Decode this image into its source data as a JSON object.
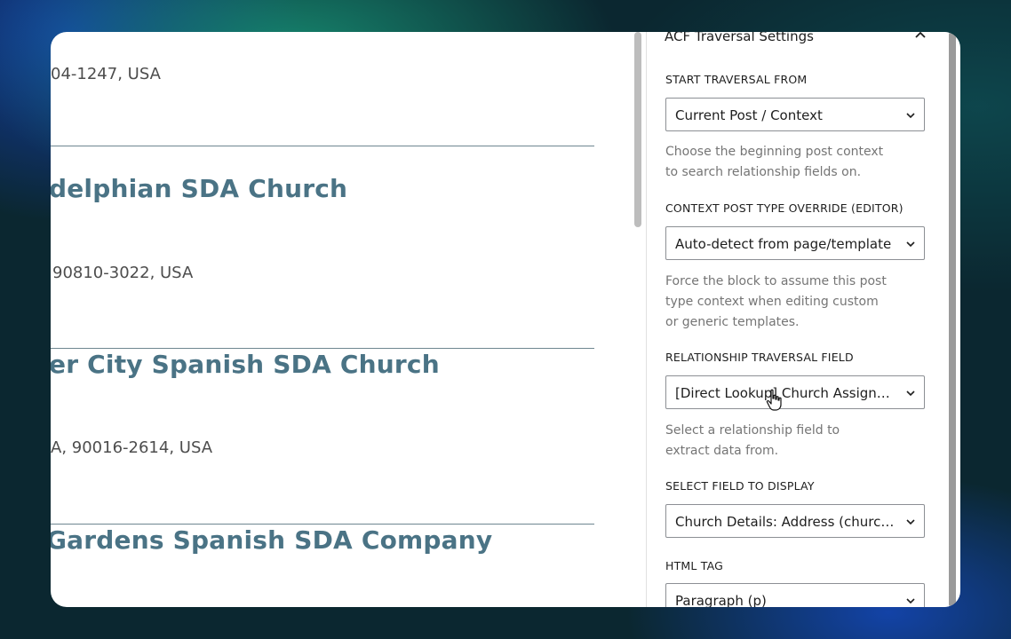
{
  "content": {
    "entries": [
      {
        "title": "",
        "address": "04-1247, USA"
      },
      {
        "title": "delphian SDA Church",
        "address": "90810-3022, USA"
      },
      {
        "title": "er City Spanish SDA Church",
        "address": "A, 90016-2614, USA"
      },
      {
        "title": "Gardens Spanish SDA Company",
        "address": ""
      }
    ]
  },
  "sidebar": {
    "panel_title": "ACF Traversal Settings",
    "fields": [
      {
        "label": "START TRAVERSAL FROM",
        "value": "Current Post / Context",
        "help": "Choose the beginning post context to search relationship fields on."
      },
      {
        "label": "CONTEXT POST TYPE OVERRIDE (EDITOR)",
        "value": "Auto-detect from page/template",
        "help": "Force the block to assume this post type context when editing custom or generic templates."
      },
      {
        "label": "RELATIONSHIP TRAVERSAL FIELD",
        "value": "[Direct Lookup] Church Assignments",
        "help": "Select a relationship field to extract data from."
      },
      {
        "label": "SELECT FIELD TO DISPLAY",
        "value": "Church Details: Address (church_address)",
        "help": ""
      },
      {
        "label": "HTML TAG",
        "value": "Paragraph (p)",
        "help": ""
      }
    ]
  },
  "icons": {
    "collapse": "chevron-up-icon",
    "dropdown": "chevron-down-icon",
    "cursor": "hand-pointer-icon"
  },
  "colors": {
    "title": "#4a7385",
    "help_text": "#757575",
    "divider": "#6f8690"
  }
}
